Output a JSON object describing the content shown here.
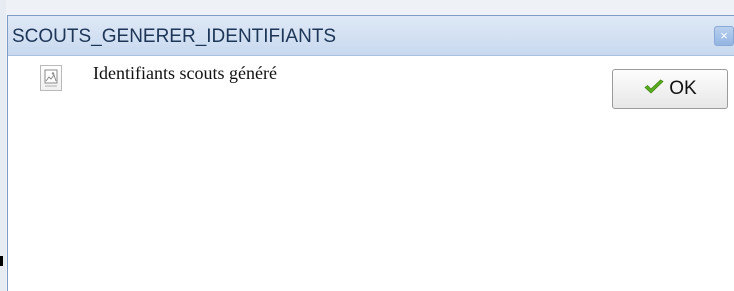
{
  "dialog": {
    "title": "SCOUTS_GENERER_IDENTIFIANTS",
    "close_icon": "close-icon",
    "message": "Identifiants scouts généré",
    "message_icon": "document-image-icon",
    "ok_label": "OK",
    "ok_icon": "check-icon"
  },
  "colors": {
    "title_bar": "#c8d9ef",
    "dialog_border": "#7d9dc8",
    "check_green": "#5cab1f"
  }
}
